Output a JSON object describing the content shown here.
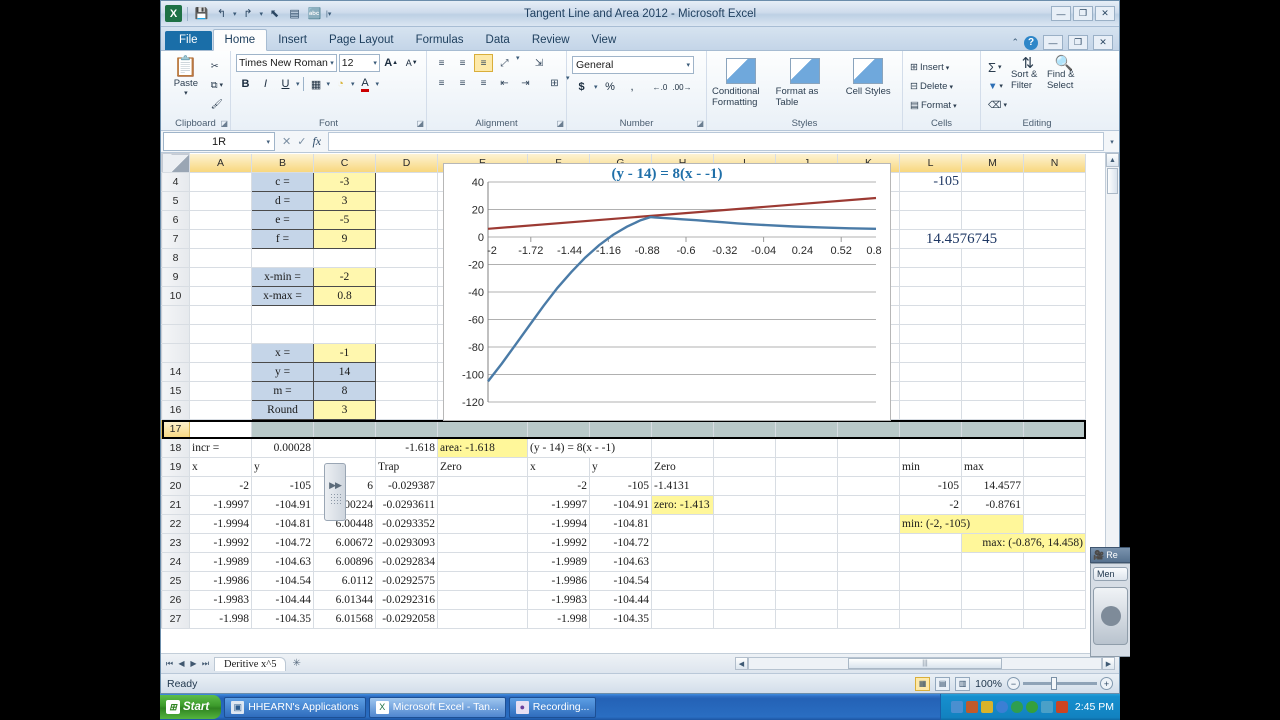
{
  "window": {
    "title": "Tangent Line and Area 2012  -  Microsoft Excel",
    "minimize": "—",
    "restore": "❐",
    "close": "✕"
  },
  "quick_access": [
    {
      "name": "excel-logo",
      "glyph": "X"
    },
    {
      "name": "save-icon",
      "glyph": "▤"
    },
    {
      "name": "undo-icon",
      "glyph": "↰"
    },
    {
      "name": "redo-icon",
      "glyph": "↱"
    },
    {
      "name": "pointer-icon",
      "glyph": "⬉"
    },
    {
      "name": "print-preview-icon",
      "glyph": "▣"
    },
    {
      "name": "spelling-icon",
      "glyph": "ᵃᵇ"
    },
    {
      "name": "customize-qat-icon",
      "glyph": "▾"
    }
  ],
  "ribbon_tabs": {
    "file": "File",
    "items": [
      "Home",
      "Insert",
      "Page Layout",
      "Formulas",
      "Data",
      "Review",
      "View"
    ],
    "active": "Home",
    "help_glyph": "?",
    "minimize_ribbon": "⌃"
  },
  "ribbon": {
    "clipboard": {
      "label": "Clipboard",
      "paste": "Paste",
      "cut": "✂",
      "copy": "⧉",
      "format_painter": "🖌"
    },
    "font": {
      "label": "Font",
      "font_name": "Times New Roman",
      "font_size": "12",
      "grow_font": "A",
      "shrink_font": "A",
      "bold": "B",
      "italic": "I",
      "underline": "U",
      "borders": "▦",
      "fill_color": "◔",
      "font_color": "A"
    },
    "alignment": {
      "label": "Alignment",
      "top_align": "≡",
      "middle_align": "≡",
      "bottom_align": "≡",
      "orientation": "⤢",
      "align_left": "≡",
      "align_center": "≡",
      "align_right": "≡",
      "decrease_indent": "⇤",
      "increase_indent": "⇥",
      "merge_center": "⊞"
    },
    "number": {
      "label": "Number",
      "format": "General",
      "accounting": "$",
      "percent": "%",
      "comma": ",",
      "increase_decimal": "←.0",
      "decrease_decimal": ".00→"
    },
    "styles": {
      "label": "Styles",
      "conditional_formatting": "Conditional Formatting",
      "format_as_table": "Format as Table",
      "cell_styles": "Cell Styles"
    },
    "cells": {
      "label": "Cells",
      "insert": "Insert",
      "delete": "Delete",
      "format": "Format"
    },
    "editing": {
      "label": "Editing",
      "autosum": "Σ",
      "fill": "▼",
      "clear": "⌫",
      "sort_filter": "Sort & Filter",
      "find_select": "Find & Select"
    }
  },
  "formula_bar": {
    "name_box": "1R",
    "cancel": "✕",
    "enter": "✓",
    "insert_function": "fx",
    "formula": "",
    "expand": "▾"
  },
  "sheet": {
    "columns": [
      "A",
      "B",
      "C",
      "D",
      "E",
      "F",
      "G",
      "H",
      "I",
      "J",
      "K",
      "L",
      "M",
      "N"
    ],
    "selected_row": 17,
    "rows": [
      {
        "n": 4,
        "B": "c =",
        "C": "-3",
        "style": "param"
      },
      {
        "n": 5,
        "B": "d =",
        "C": "3",
        "style": "param"
      },
      {
        "n": 6,
        "B": "e =",
        "C": "-5",
        "style": "param"
      },
      {
        "n": 7,
        "B": "f =",
        "C": "9",
        "style": "param"
      },
      {
        "n": 8,
        "B": "",
        "C": ""
      },
      {
        "n": 9,
        "B": "x-min =",
        "C": "-2",
        "style": "param"
      },
      {
        "n": 10,
        "B": "x-max =",
        "C": "0.8",
        "style": "param"
      },
      {
        "n": 14,
        "B": "y =",
        "C": "14",
        "style": "param-blue"
      },
      {
        "n": 15,
        "B": "m =",
        "C": "8",
        "style": "param-blue"
      },
      {
        "n": 16,
        "B": "Round",
        "C": "3",
        "style": "param"
      }
    ],
    "hidden_row_13": {
      "B": "x =",
      "C": "-1"
    },
    "big_values": {
      "minus105": "-105",
      "max_y": "14.4576745"
    },
    "row17": {
      "selected": true
    },
    "row18": {
      "A": "incr =",
      "B": "0.00028",
      "D": "-1.618",
      "E": "area: -1.618",
      "F": "(y - 14) = 8(x - -1)"
    },
    "row19_headers": {
      "A": "x",
      "B": "y",
      "D": "Trap",
      "E": "Zero",
      "G": "x",
      "H": "y",
      "I": "Zero",
      "L": "min",
      "M": "max"
    },
    "data_rows": [
      {
        "n": 20,
        "x": "-2",
        "y": "-105",
        "c": "6",
        "trap": "-0.029387",
        "gx": "-2",
        "gy": "-105",
        "zero": "-1.4131",
        "min": "-105",
        "max": "14.4577"
      },
      {
        "n": 21,
        "x": "-1.9997",
        "y": "-104.91",
        "c": "6.00224",
        "trap": "-0.0293611",
        "gx": "-1.9997",
        "gy": "-104.91",
        "zero_hl": "zero: -1.413",
        "min": "-2",
        "max": "-0.8761"
      },
      {
        "n": 22,
        "x": "-1.9994",
        "y": "-104.81",
        "c": "6.00448",
        "trap": "-0.0293352",
        "gx": "-1.9994",
        "gy": "-104.81",
        "note_min": "min: (-2, -105)"
      },
      {
        "n": 23,
        "x": "-1.9992",
        "y": "-104.72",
        "c": "6.00672",
        "trap": "-0.0293093",
        "gx": "-1.9992",
        "gy": "-104.72",
        "note_max": "max: (-0.876, 14.458)"
      },
      {
        "n": 24,
        "x": "-1.9989",
        "y": "-104.63",
        "c": "6.00896",
        "trap": "-0.0292834",
        "gx": "-1.9989",
        "gy": "-104.63"
      },
      {
        "n": 25,
        "x": "-1.9986",
        "y": "-104.54",
        "c": "6.0112",
        "trap": "-0.0292575",
        "gx": "-1.9986",
        "gy": "-104.54"
      },
      {
        "n": 26,
        "x": "-1.9983",
        "y": "-104.44",
        "c": "6.01344",
        "trap": "-0.0292316",
        "gx": "-1.9983",
        "gy": "-104.44"
      },
      {
        "n": 27,
        "x": "-1.998",
        "y": "-104.35",
        "c": "6.01568",
        "trap": "-0.0292058",
        "gx": "-1.998",
        "gy": "-104.35"
      }
    ]
  },
  "chart_data": {
    "type": "line",
    "title": "(y - 14) = 8(x - -1)",
    "xlabel": "",
    "ylabel": "",
    "xlim": [
      -2,
      0.8
    ],
    "ylim": [
      -120,
      40
    ],
    "grid": true,
    "legend": "none",
    "xticks": [
      "-2",
      "-1.72",
      "-1.44",
      "-1.16",
      "-0.88",
      "-0.6",
      "-0.32",
      "-0.04",
      "0.24",
      "0.52",
      "0.8"
    ],
    "yticks": [
      "40",
      "20",
      "0",
      "-20",
      "-40",
      "-60",
      "-80",
      "-100",
      "-120"
    ],
    "series": [
      {
        "name": "curve",
        "color": "#4a7ba7",
        "x": [
          -2,
          -1.9,
          -1.8,
          -1.7,
          -1.6,
          -1.5,
          -1.4,
          -1.3,
          -1.2,
          -1.1,
          -1.0,
          -0.9,
          -0.876,
          -0.8,
          -0.7,
          -0.6,
          -0.5,
          -0.4,
          -0.3,
          -0.2,
          -0.1,
          0,
          0.2,
          0.4,
          0.6,
          0.8
        ],
        "y": [
          -105,
          -92,
          -78,
          -64,
          -50,
          -37,
          -25.5,
          -15,
          -6,
          1.5,
          7.5,
          12.2,
          14.458,
          14.2,
          13.6,
          12.9,
          12.2,
          11.4,
          10.7,
          9.9,
          9.2,
          8.6,
          7.6,
          6.9,
          6.3,
          6.0
        ]
      },
      {
        "name": "tangent",
        "color": "#9c3a33",
        "x": [
          -2,
          0.8
        ],
        "y": [
          6,
          28.4
        ]
      }
    ]
  },
  "sheet_tabs": {
    "first": "⏮",
    "prev": "◀",
    "next": "▶",
    "last": "⏭",
    "tabs": [
      "Deritive x^5"
    ],
    "new_sheet": "✳"
  },
  "status_bar": {
    "status": "Ready",
    "view_normal": "▦",
    "view_page_layout": "▤",
    "view_page_break": "▥",
    "zoom": "100%",
    "zoom_out": "−",
    "zoom_in": "+"
  },
  "recording_overlay": {
    "title": "Re",
    "menu": "Men"
  },
  "taskbar": {
    "start": "Start",
    "items": [
      {
        "label": "HHEARN's Applications",
        "icon": "🗔",
        "active": false
      },
      {
        "label": "Microsoft Excel - Tan...",
        "icon": "X",
        "active": true
      },
      {
        "label": "Recording...",
        "icon": "🎙",
        "active": false
      }
    ],
    "clock": "2:45 PM",
    "tray_icons": [
      "#4a8fd0",
      "#c05a2a",
      "#d8b32a",
      "#3b7fd4",
      "#2f9e4f",
      "#35a03b",
      "#4aa0c8",
      "#cc4422"
    ]
  },
  "colors": {
    "title_blue": "#1f3864",
    "chart_curve": "#4a7ba7",
    "chart_tangent": "#9c3a33",
    "highlight_yellow": "#fff79a",
    "param_yellow": "#fff7ae",
    "param_blue": "#c5d5e8"
  }
}
